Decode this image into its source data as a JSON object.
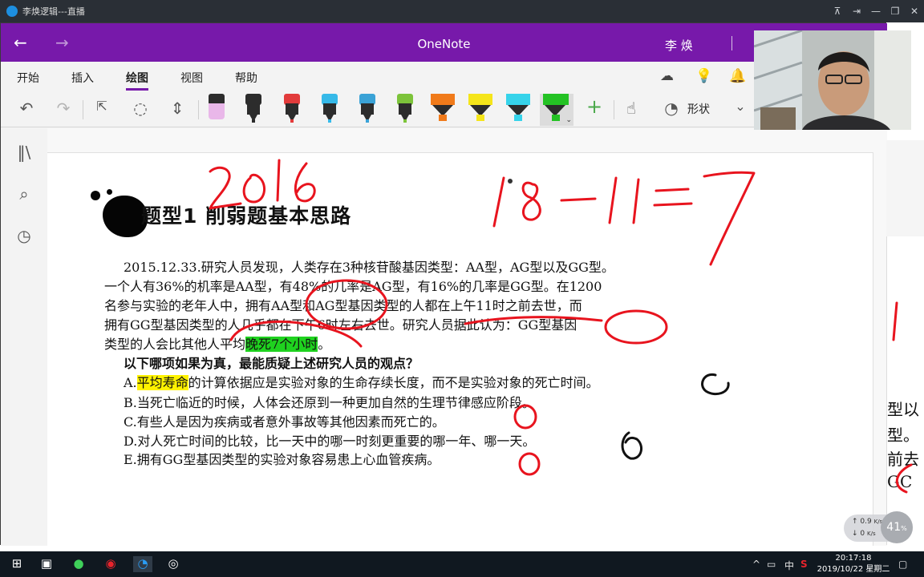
{
  "window": {
    "title": "李焕逻辑---直播"
  },
  "onenote": {
    "app_title": "OneNote",
    "user": "李 焕",
    "tabs": [
      "开始",
      "插入",
      "绘图",
      "视图",
      "帮助"
    ],
    "active_tab": "绘图",
    "shapes_label": "形状"
  },
  "pens": {
    "colors": [
      "#e9b7e9",
      "#2c2c2c",
      "#e23b3b",
      "#36b9e8",
      "#3aa2d6",
      "#7cc33a",
      "#f07a1a",
      "#f5e51a",
      "#36d3ea",
      "#24c224"
    ]
  },
  "note": {
    "heading": "题型1  削弱题基本思路",
    "question_lines": [
      "2015.12.33.研究人员发现，人类存在3种核苷酸基因类型：AA型，AG型以及GG型。",
      "一个人有36%的机率是AA型，有48%的几率是AG型，有16%的几率是GG型。在1200",
      "名参与实验的老年人中，拥有AA型和AG型基因类型的人都在上午11时之前去世，而",
      "拥有GG型基因类型的人几乎都在下午6时左右去世。研究人员据此认为：GG型基因"
    ],
    "last_line_pre": "类型的人会比其他人平均",
    "last_line_hl": "晚死7个小时",
    "last_line_post": "。",
    "prompt": "以下哪项如果为真，最能质疑上述研究人员的观点？",
    "options": [
      {
        "letter": "A.",
        "hl": "平均寿命",
        "text": "的计算依据应是实验对象的生命存续长度，而不是实验对象的死亡时间。"
      },
      {
        "letter": "B.",
        "hl": "",
        "text": "当死亡临近的时候，人体会还原到一种更加自然的生理节律感应阶段。"
      },
      {
        "letter": "C.",
        "hl": "",
        "text": "有些人是因为疾病或者意外事故等其他因素而死亡的。"
      },
      {
        "letter": "D.",
        "hl": "",
        "text": "对人死亡时间的比较，比一天中的哪一时刻更重要的哪一年、哪一天。"
      },
      {
        "letter": "E.",
        "hl": "",
        "text": "拥有GG型基因类型的实验对象容易患上心血管疾病。"
      }
    ],
    "right_fragments": [
      "型以",
      "型。",
      "前去",
      "GC"
    ]
  },
  "network": {
    "up": "0.9",
    "up_unit": "K/s",
    "down": "0",
    "down_unit": "K/s",
    "percent": "41",
    "percent_unit": "%"
  },
  "taskbar": {
    "tray": {
      "ime": "中",
      "expand": "^"
    },
    "time": "20:17:18",
    "date": "2019/10/22 星期二"
  }
}
